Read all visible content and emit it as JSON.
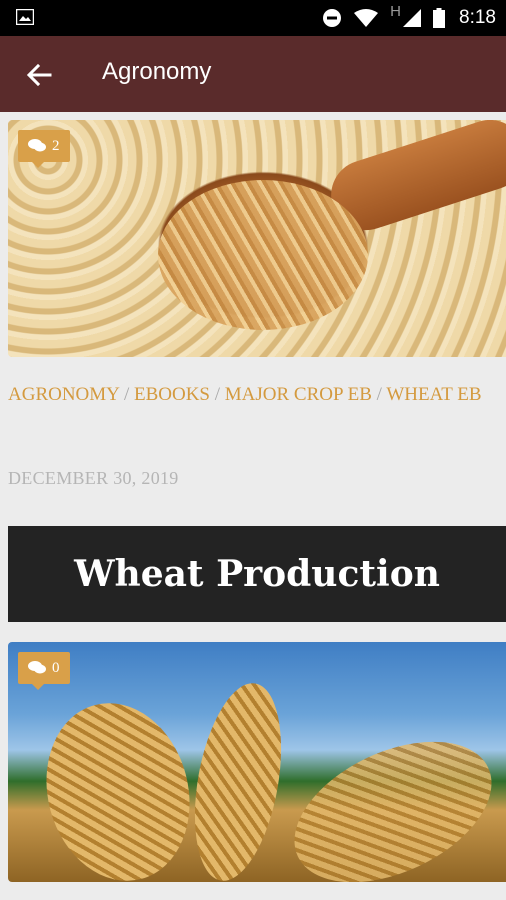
{
  "status_bar": {
    "time": "8:18",
    "network_label": "H",
    "icons": [
      "gallery-icon",
      "do-not-disturb-icon",
      "wifi-icon",
      "cell-signal-icon",
      "battery-icon"
    ]
  },
  "app_bar": {
    "title": "Agronomy",
    "back_icon": "arrow-left-icon",
    "color": "#5a2b2b"
  },
  "posts": [
    {
      "comment_count": "2",
      "categories": [
        "AGRONOMY",
        "EBOOKS",
        "MAJOR CROP EB",
        "WHEAT EB"
      ],
      "separator": "/",
      "date": "DECEMBER 30, 2019",
      "banner_title": "Wheat Production"
    },
    {
      "comment_count": "0"
    }
  ],
  "colors": {
    "accent": "#d9a049",
    "category_text": "#d49a3f",
    "date_text": "#b5b5b5",
    "banner_bg": "#232323",
    "page_bg": "#ececec"
  }
}
